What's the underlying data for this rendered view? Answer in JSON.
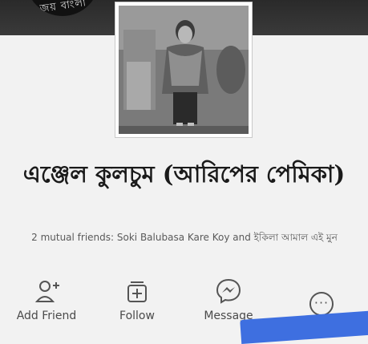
{
  "cover": {
    "badge_text": "জয় বাংলা"
  },
  "profile": {
    "name": "এঞ্জেল কুলচুম (আরিপের পেমিকা)",
    "mutual_friends": "2 mutual friends: Soki Balubasa Kare Koy and ইকিলা আমাল এই মুন"
  },
  "actions": {
    "add_friend": "Add Friend",
    "follow": "Follow",
    "message": "Message",
    "more": "···"
  },
  "colors": {
    "messenger_accent": "#3e6fe0",
    "icon_stroke": "#555555"
  }
}
